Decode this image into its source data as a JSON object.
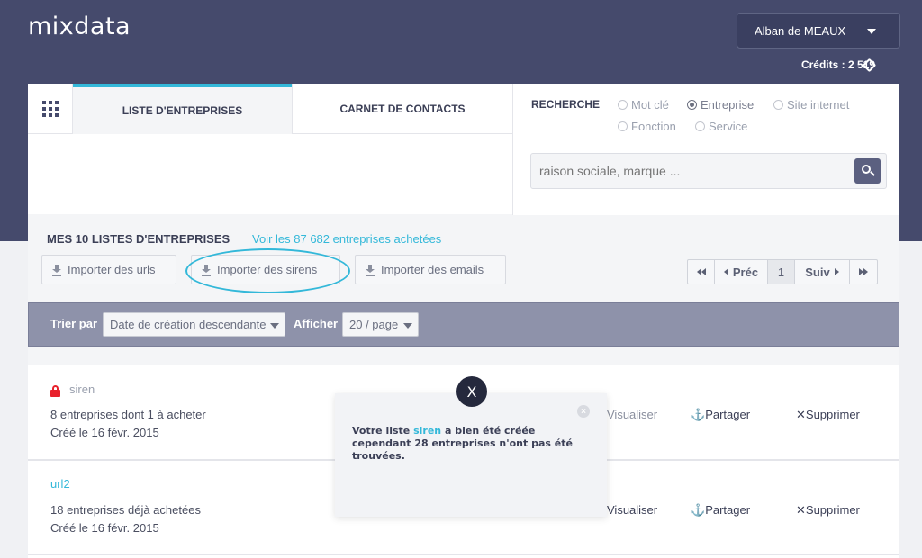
{
  "app": {
    "logo": "mixdata"
  },
  "user": {
    "name": "Alban de MEAUX",
    "credits": "Crédits : 2 519"
  },
  "tabs": [
    {
      "label": "LISTE D'ENTREPRISES",
      "active": true
    },
    {
      "label": "CARNET DE CONTACTS",
      "active": false
    }
  ],
  "search": {
    "label": "RECHERCHE",
    "options": [
      "Mot clé",
      "Entreprise",
      "Site internet",
      "Fonction",
      "Service"
    ],
    "selected": "Entreprise",
    "placeholder": "raison sociale, marque ..."
  },
  "lists": {
    "title": "MES 10 LISTES D'ENTREPRISES",
    "link": "Voir les 87 682 entreprises achetées",
    "import_buttons": [
      "Importer des urls",
      "Importer des sirens",
      "Importer des emails"
    ],
    "highlighted_button": "Importer des sirens"
  },
  "pager": {
    "prev": "Préc",
    "page": "1",
    "next": "Suiv"
  },
  "filters": {
    "sort_label": "Trier par",
    "sort_value": "Date de création descendante",
    "show_label": "Afficher",
    "show_value": "20 / page"
  },
  "rows": [
    {
      "name": "siren",
      "locked": true,
      "desc": "8 entreprises dont 1 à acheter",
      "created": "Créé le 16 févr. 2015",
      "view": "Visualiser",
      "share": "Partager",
      "delete": "Supprimer"
    },
    {
      "name": "url2",
      "locked": false,
      "desc": "18 entreprises déjà achetées",
      "created": "Créé le 16 févr. 2015",
      "view": "Visualiser",
      "share": "Partager",
      "delete": "Supprimer"
    }
  ],
  "toast": {
    "close": "X",
    "msg_before": "Votre liste ",
    "msg_highlight": "siren",
    "msg_after": " a bien été créée cependant 28 entreprises n'ont pas été trouvées."
  },
  "colors": {
    "header": "#454a6c",
    "accent": "#33b8d9",
    "lock": "#e8212c",
    "filter_bar": "#8e92aa"
  }
}
